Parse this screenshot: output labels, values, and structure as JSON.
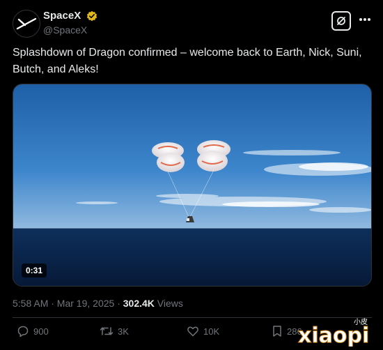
{
  "tweet": {
    "display_name": "SpaceX",
    "handle": "@SpaceX",
    "text": "Splashdown of Dragon confirmed – welcome back to Earth, Nick, Suni, Butch, and Aleks!",
    "timestamp": "5:58 AM · Mar 19, 2025 · ",
    "views_count": "302.4K",
    "views_label": " Views"
  },
  "media": {
    "duration": "0:31"
  },
  "actions": {
    "replies": "900",
    "reposts": "3K",
    "likes": "10K",
    "bookmarks": "286"
  },
  "watermark": {
    "text": "xiaopi",
    "small_text": "小皮"
  },
  "colors": {
    "background": "#000000",
    "text": "#e7e9ea",
    "muted": "#71767b",
    "verified": "#e2b719"
  },
  "icons": [
    "spacex-logo-icon",
    "verified-icon",
    "grok-icon",
    "more-icon",
    "reply-icon",
    "repost-icon",
    "like-icon",
    "bookmark-icon"
  ]
}
